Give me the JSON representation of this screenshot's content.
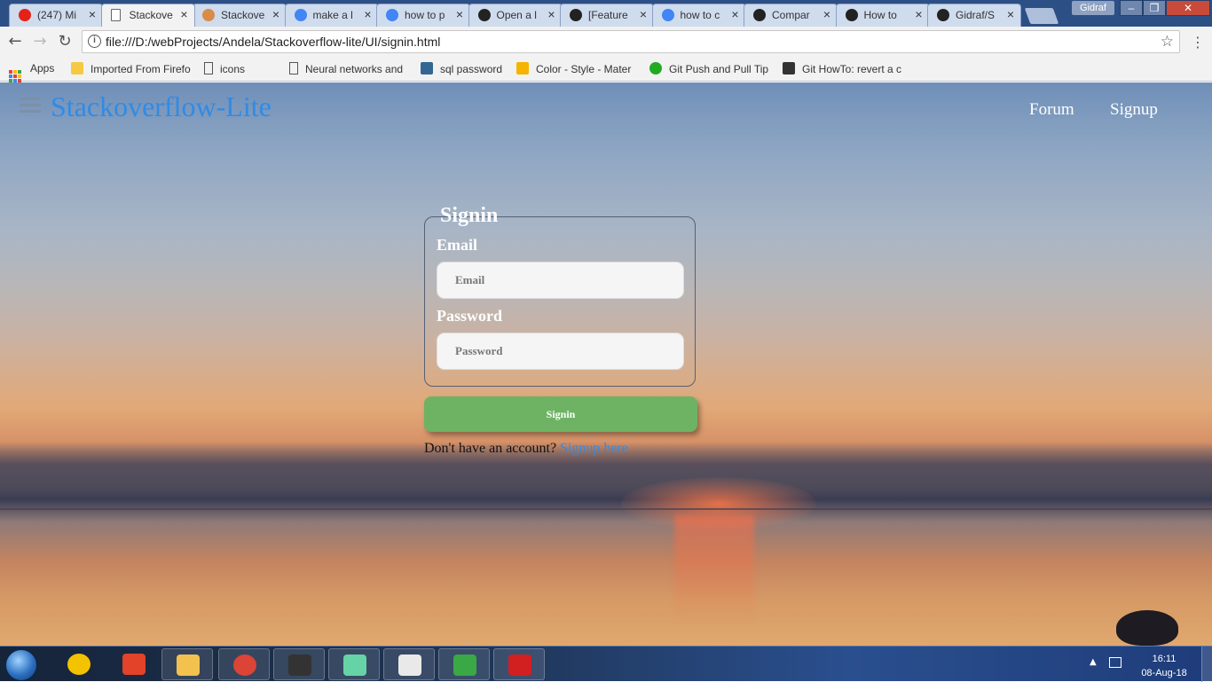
{
  "browser": {
    "tabs": [
      {
        "title": "(247) Mi",
        "favicon": "youtube-icon",
        "color": "#e62117"
      },
      {
        "title": "Stackove",
        "favicon": "page-icon",
        "color": "#ffffff",
        "active": true
      },
      {
        "title": "Stackove",
        "favicon": "stackoverflow-icon",
        "color": "#d98c4a"
      },
      {
        "title": "make a l",
        "favicon": "google-icon",
        "color": "#4285f4"
      },
      {
        "title": "how to p",
        "favicon": "google-icon",
        "color": "#4285f4"
      },
      {
        "title": "Open a l",
        "favicon": "github-icon",
        "color": "#222222"
      },
      {
        "title": "[Feature",
        "favicon": "github-icon",
        "color": "#222222"
      },
      {
        "title": "how to c",
        "favicon": "google-icon",
        "color": "#4285f4"
      },
      {
        "title": "Compar",
        "favicon": "github-icon",
        "color": "#222222"
      },
      {
        "title": "How to",
        "favicon": "github-icon",
        "color": "#222222"
      },
      {
        "title": "Gidraf/S",
        "favicon": "github-icon",
        "color": "#222222"
      }
    ],
    "user_name": "Gidraf",
    "window_buttons": {
      "minimize": "–",
      "maximize": "❐",
      "close": "✕"
    },
    "nav": {
      "back": "←",
      "forward": "→",
      "reload": "↻"
    },
    "url": "file:///D:/webProjects/Andela/Stackoverflow-lite/UI/signin.html",
    "info_glyph": "i",
    "star_glyph": "☆",
    "menu_glyph": "⋮",
    "bookmarks": [
      {
        "label": "Apps",
        "icon": "apps-grid-icon"
      },
      {
        "label": "Imported From Firefo",
        "icon": "folder-icon",
        "color": "#f6c945"
      },
      {
        "label": "icons",
        "icon": "page-icon"
      },
      {
        "label": "Neural networks and",
        "icon": "page-icon"
      },
      {
        "label": "sql password",
        "icon": "postgres-icon",
        "color": "#336791"
      },
      {
        "label": "Color - Style - Mater",
        "icon": "material-icon",
        "color": "#f4b400"
      },
      {
        "label": "Git Push and Pull Tip",
        "icon": "clock-icon",
        "color": "#22aa22"
      },
      {
        "label": "Git HowTo: revert a c",
        "icon": "avatar-icon",
        "color": "#333333"
      }
    ]
  },
  "page": {
    "brand": "Stackoverflow-Lite",
    "nav_links": [
      "Forum",
      "Signup"
    ],
    "form": {
      "legend": "Signin",
      "email_label": "Email",
      "email_placeholder": "Email",
      "password_label": "Password",
      "password_placeholder": "Password",
      "submit_label": "Signin",
      "prompt_text": "Don't have an account?",
      "signup_link_text": "Signup here"
    },
    "colors": {
      "brand": "#2f8be6",
      "button": "#6db363",
      "link": "#2f8be6"
    }
  },
  "taskbar": {
    "apps": [
      {
        "name": "arduino-like-icon",
        "color": "#f3c300"
      },
      {
        "name": "git-icon",
        "color": "#e24329"
      },
      {
        "name": "explorer-icon",
        "color": "#f2c14e"
      },
      {
        "name": "chrome-icon",
        "color": "#db4437"
      },
      {
        "name": "cmd-icon",
        "color": "#333333"
      },
      {
        "name": "atom-icon",
        "color": "#66d3a6"
      },
      {
        "name": "slack-icon",
        "color": "#e9e9e9"
      },
      {
        "name": "idm-icon",
        "color": "#3aa845"
      },
      {
        "name": "acrobat-icon",
        "color": "#d21f1f"
      }
    ],
    "time": "16:11",
    "date": "08-Aug-18"
  }
}
